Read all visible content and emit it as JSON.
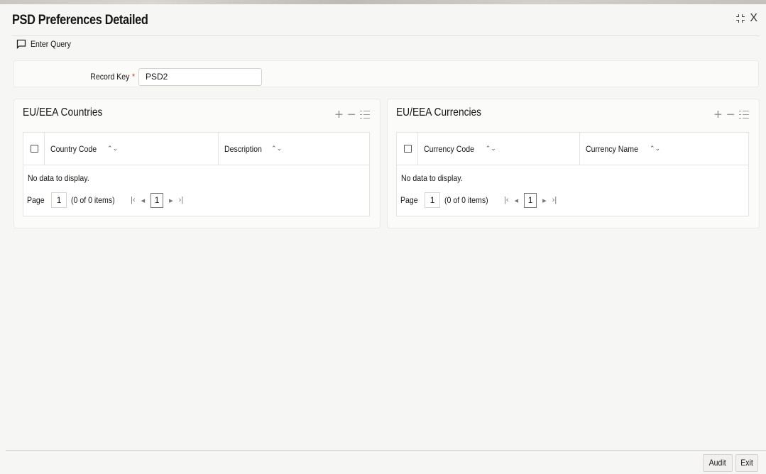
{
  "window": {
    "title": "PSD Preferences Detailed",
    "close_symbol": "X"
  },
  "toolbar": {
    "enter_query_label": "Enter Query"
  },
  "record": {
    "label": "Record Key",
    "required_mark": "*",
    "value": "PSD2"
  },
  "panels": [
    {
      "title": "EU/EEA Countries",
      "columns": [
        "Country Code",
        "Description"
      ],
      "empty_text": "No data to display.",
      "pager": {
        "page_label": "Page",
        "page_value": "1",
        "items_text": "(0 of 0 items)",
        "current_page": "1"
      }
    },
    {
      "title": "EU/EEA Currencies",
      "columns": [
        "Currency Code",
        "Currency Name"
      ],
      "empty_text": "No data to display.",
      "pager": {
        "page_label": "Page",
        "page_value": "1",
        "items_text": "(0 of 0 items)",
        "current_page": "1"
      }
    }
  ],
  "footer": {
    "audit_label": "Audit",
    "exit_label": "Exit"
  },
  "icons": {
    "add": "plus-icon",
    "remove": "minus-icon",
    "columns": "list-icon",
    "sort": "sort-icon",
    "first": "first-page-icon",
    "prev": "prev-page-icon",
    "next": "next-page-icon",
    "last": "last-page-icon",
    "shrink": "shrink-icon",
    "close": "close-icon",
    "query": "chat-bubble-icon"
  },
  "colors": {
    "background": "#f6f6f5",
    "panel": "#fbfbfa",
    "required": "#c74634"
  }
}
